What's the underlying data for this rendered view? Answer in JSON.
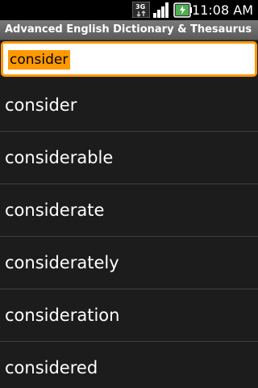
{
  "status_bar": {
    "network_icon": "3g-icon",
    "signal_icon": "signal-bars-icon",
    "battery_icon": "battery-charging-icon",
    "network_label": "3G",
    "time": "11:08 AM"
  },
  "app": {
    "title": "Advanced English Dictionary & Thesaurus"
  },
  "search": {
    "value": "consider",
    "accent_color": "#ff9900"
  },
  "words": [
    {
      "label": "consider"
    },
    {
      "label": "considerable"
    },
    {
      "label": "considerate"
    },
    {
      "label": "considerately"
    },
    {
      "label": "consideration"
    },
    {
      "label": "considered"
    }
  ]
}
